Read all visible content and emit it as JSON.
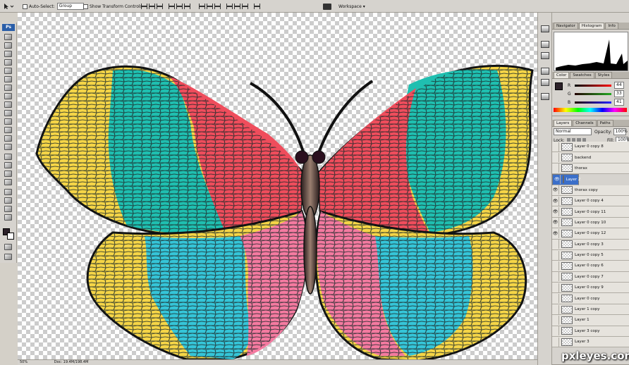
{
  "options_bar": {
    "auto_select_label": "Auto-Select:",
    "auto_select_value": "Group",
    "show_transform_label": "Show Transform Controls",
    "workspace_label": "Workspace ▾"
  },
  "toolbox": {
    "logo": "Ps"
  },
  "status_bar": {
    "zoom": "50%",
    "doc": "Doc: 19.4M/198.4M"
  },
  "panels": {
    "nav_tabs": [
      "Navigator",
      "Histogram",
      "Info"
    ],
    "color_tabs": [
      "Color",
      "Swatches",
      "Styles"
    ],
    "color": {
      "r_label": "R",
      "g_label": "G",
      "b_label": "B",
      "r": "44",
      "g": "33",
      "b": "41"
    },
    "layer_tabs": [
      "Layers",
      "Channels",
      "Paths"
    ],
    "blend_mode": "Normal",
    "opacity_label": "Opacity:",
    "opacity": "100%",
    "lock_label": "Lock:",
    "fill_label": "Fill:",
    "fill": "100%",
    "layers": [
      {
        "name": "Layer 0 copy 8",
        "visible": false,
        "selected": false
      },
      {
        "name": "backend",
        "visible": false,
        "selected": false
      },
      {
        "name": "thorax",
        "visible": false,
        "selected": false
      },
      {
        "name": "Layer 2",
        "visible": true,
        "selected": true
      },
      {
        "name": "thorax copy",
        "visible": true,
        "selected": false
      },
      {
        "name": "Layer 0 copy 4",
        "visible": true,
        "selected": false
      },
      {
        "name": "Layer 0 copy 11",
        "visible": true,
        "selected": false
      },
      {
        "name": "Layer 0 copy 10",
        "visible": true,
        "selected": false
      },
      {
        "name": "Layer 0 copy 12",
        "visible": true,
        "selected": false
      },
      {
        "name": "Layer 0 copy 3",
        "visible": false,
        "selected": false
      },
      {
        "name": "Layer 0 copy 5",
        "visible": false,
        "selected": false
      },
      {
        "name": "Layer 0 copy 6",
        "visible": false,
        "selected": false
      },
      {
        "name": "Layer 0 copy 7",
        "visible": false,
        "selected": false
      },
      {
        "name": "Layer 0 copy 9",
        "visible": false,
        "selected": false
      },
      {
        "name": "Layer 0 copy",
        "visible": false,
        "selected": false
      },
      {
        "name": "Layer 1 copy",
        "visible": false,
        "selected": false
      },
      {
        "name": "Layer 1",
        "visible": false,
        "selected": false
      },
      {
        "name": "Layer 3 copy",
        "visible": false,
        "selected": false
      },
      {
        "name": "Layer 3",
        "visible": false,
        "selected": false
      }
    ]
  },
  "watermark": "pxleyes.com",
  "colors": {
    "yellow": "#f5d547",
    "teal": "#1fbfb0",
    "cyan": "#35c5d8",
    "red": "#ef4d5c",
    "pink": "#f47aa0",
    "select": "#3b6fc9"
  }
}
